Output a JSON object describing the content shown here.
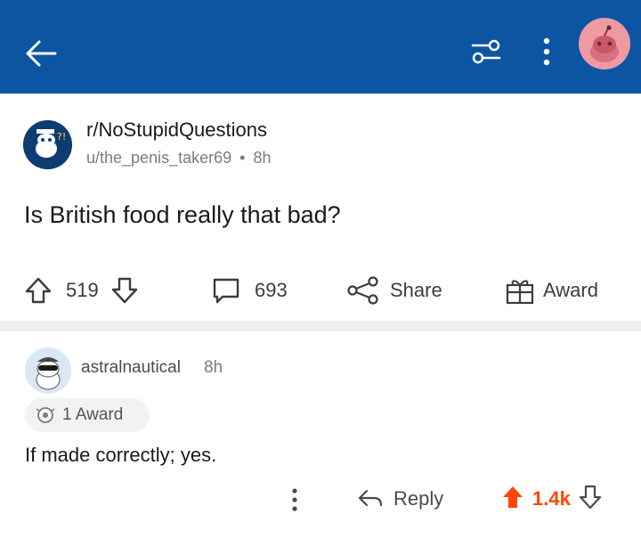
{
  "colors": {
    "header_bg": "#0c55a3",
    "upvote_active": "#ff4500",
    "divider": "#edeff1"
  },
  "header": {
    "back_icon": "arrow-left-icon",
    "filter_icon": "sliders-icon",
    "more_icon": "vertical-dots-icon",
    "avatar_icon": "user-avatar"
  },
  "post": {
    "subreddit": "r/NoStupidQuestions",
    "author": "u/the_penis_taker69",
    "separator": "•",
    "age": "8h",
    "title": "Is British food really that bad?",
    "upvotes": "519",
    "comments": "693",
    "share_label": "Share",
    "award_label": "Award"
  },
  "comment": {
    "author": "astralnautical",
    "age": "8h",
    "award_text": "1 Award",
    "body": "If made correctly; yes.",
    "reply_label": "Reply",
    "score": "1.4k",
    "upvoted": true
  }
}
